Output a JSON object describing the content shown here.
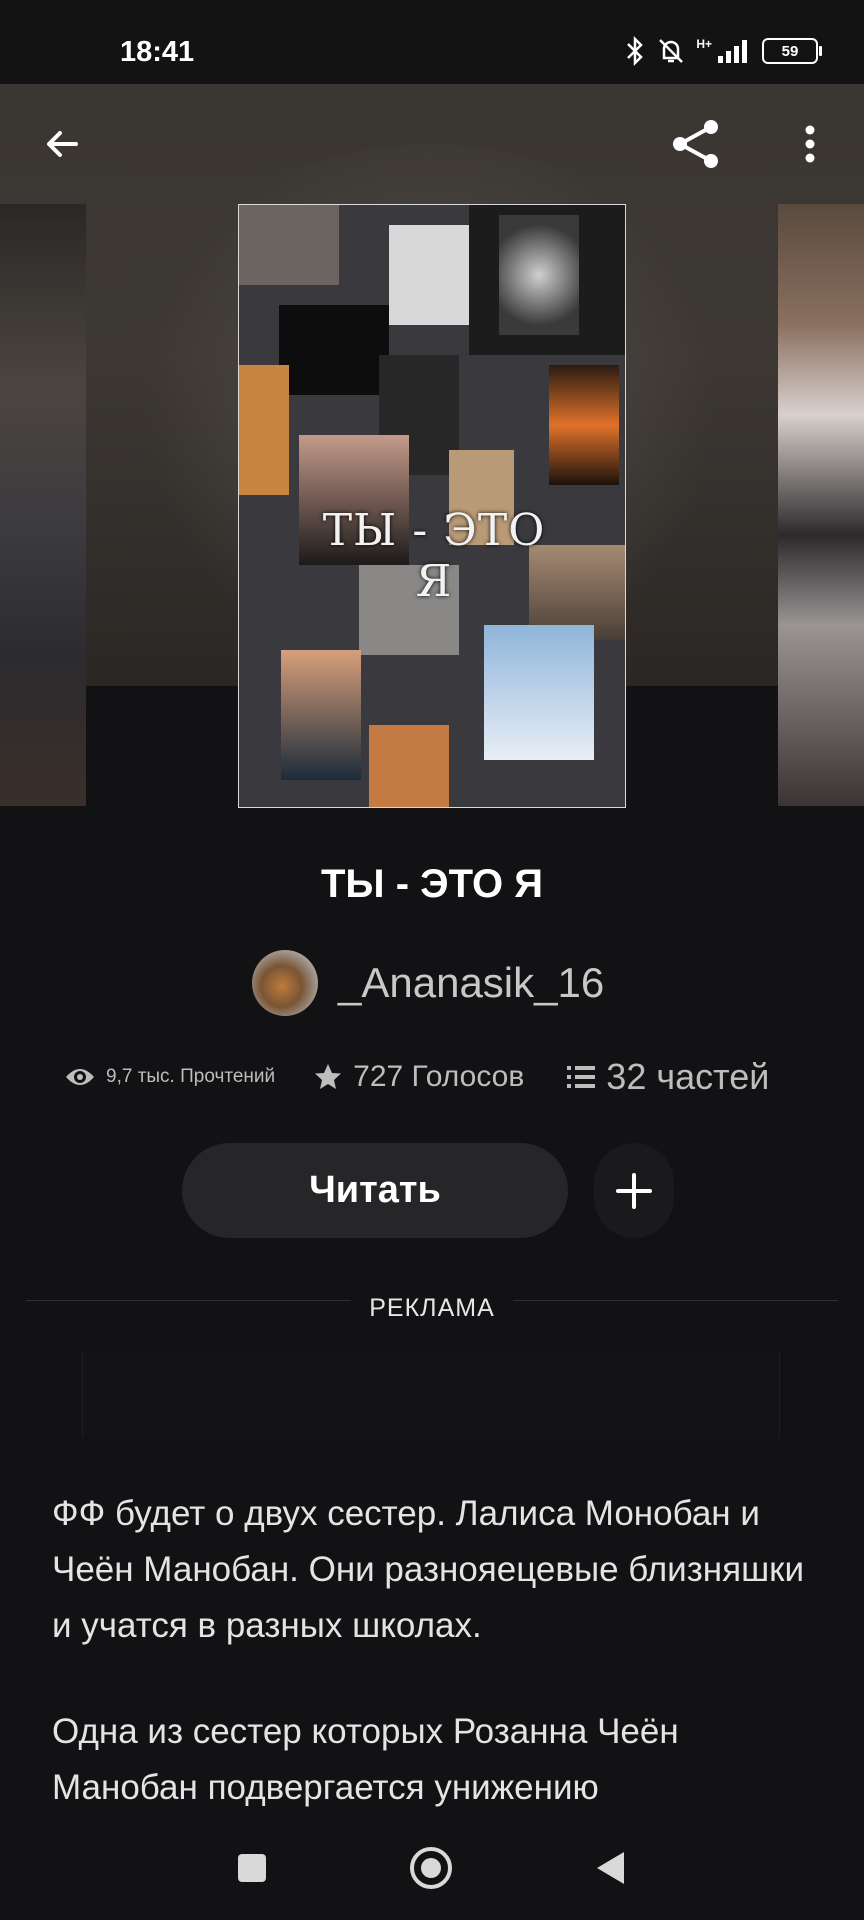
{
  "status_bar": {
    "time": "18:41",
    "network": "H+",
    "battery": "59"
  },
  "toolbar": {
    "back_icon": "arrow-left-icon",
    "share_icon": "share-icon",
    "more_icon": "more-vert-icon"
  },
  "cover": {
    "title_art": "ТЫ - ЭТО Я"
  },
  "story": {
    "title": "ТЫ - ЭТО Я",
    "author": "_Ananasik_16",
    "stats": {
      "reads": "9,7 тыс. Прочтений",
      "votes": "727 Голосов",
      "parts": "32 частей"
    }
  },
  "actions": {
    "read_label": "Читать",
    "add_icon": "plus-icon"
  },
  "ad": {
    "label": "РЕКЛАМА"
  },
  "description": {
    "paragraph_1": "ФФ будет о двух сестер. Лалиса Монобан и Чеён Манобан. Они разнояецевые близняшки и учатся в разных школах.",
    "paragraph_2": "Одна из сестер которых Розанна Чеён Манобан подвергается унижению"
  },
  "nav": {
    "recents_icon": "square-icon",
    "home_icon": "circle-home-icon",
    "back_icon": "triangle-back-icon"
  }
}
